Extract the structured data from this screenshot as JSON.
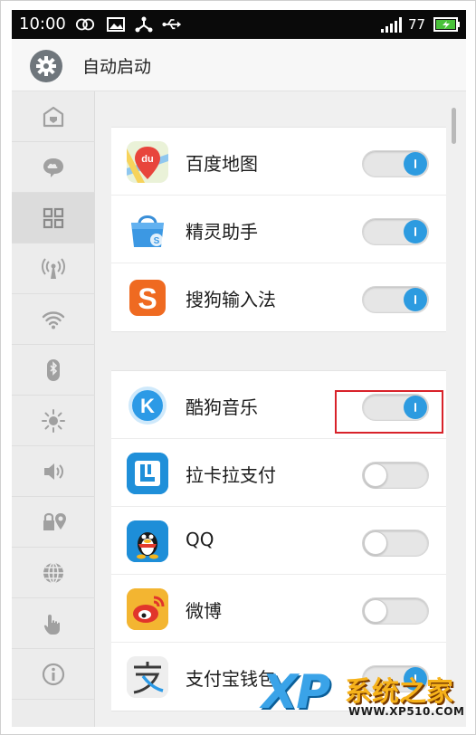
{
  "status_bar": {
    "time": "10:00",
    "battery": "77",
    "icons": [
      "infinity-icon",
      "image-icon",
      "network-share-icon",
      "usb-icon",
      "signal-icon",
      "battery-icon"
    ]
  },
  "header": {
    "icon": "gear-icon",
    "title": "自动启动"
  },
  "sidebar": {
    "items": [
      {
        "icon": "home-icon",
        "active": false
      },
      {
        "icon": "cloud-chat-icon",
        "active": false
      },
      {
        "icon": "grid-apps-icon",
        "active": true
      },
      {
        "icon": "antenna-icon",
        "active": false
      },
      {
        "icon": "wifi-icon",
        "active": false
      },
      {
        "icon": "bluetooth-icon",
        "active": false
      },
      {
        "icon": "brightness-icon",
        "active": false
      },
      {
        "icon": "volume-icon",
        "active": false
      },
      {
        "icon": "lock-location-icon",
        "active": false
      },
      {
        "icon": "globe-icon",
        "active": false
      },
      {
        "icon": "touch-icon",
        "active": false
      },
      {
        "icon": "info-icon",
        "active": false
      }
    ]
  },
  "groups": [
    {
      "apps": [
        {
          "name": "百度地图",
          "icon": "baidu-map-icon",
          "enabled": true
        },
        {
          "name": "精灵助手",
          "icon": "shopping-bag-icon",
          "enabled": true
        },
        {
          "name": "搜狗输入法",
          "icon": "sogou-icon",
          "enabled": true
        }
      ]
    },
    {
      "apps": [
        {
          "name": "酷狗音乐",
          "icon": "kugou-icon",
          "enabled": true
        },
        {
          "name": "拉卡拉支付",
          "icon": "lakala-icon",
          "enabled": false
        },
        {
          "name": "QQ",
          "icon": "qq-penguin-icon",
          "enabled": false
        },
        {
          "name": "微博",
          "icon": "weibo-icon",
          "enabled": false
        },
        {
          "name": "支付宝钱包",
          "icon": "alipay-icon",
          "enabled": true
        }
      ]
    }
  ],
  "watermark": {
    "logo": "XP",
    "brand": "系统之家",
    "url": "WWW.XP510.COM"
  },
  "colors": {
    "toggle_on": "#2d9be0",
    "highlight": "#d8222a",
    "status_bar": "#0a0a0a"
  }
}
